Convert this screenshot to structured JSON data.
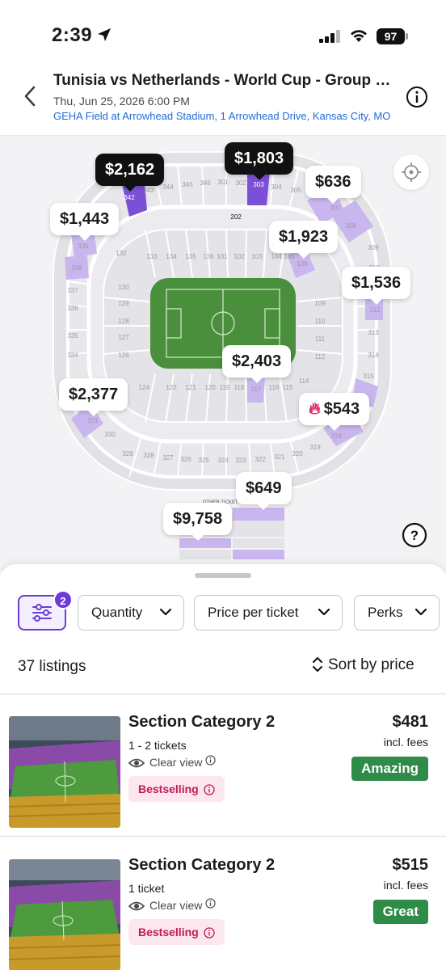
{
  "status_bar": {
    "time": "2:39",
    "battery": "97"
  },
  "event": {
    "title": "Tunisia vs Netherlands - World Cup - Group Stage",
    "datetime": "Thu, Jun 25, 2026 6:00 PM",
    "venue": "GEHA Field at Arrowhead Stadium, 1 Arrowhead Drive, Kansas City, MO"
  },
  "map": {
    "price_pins": [
      {
        "label": "$2,162",
        "style": "dark",
        "section": "342"
      },
      {
        "label": "$1,803",
        "style": "dark",
        "section": "303"
      },
      {
        "label": "$636",
        "style": "light",
        "section": "307"
      },
      {
        "label": "$1,443",
        "style": "light",
        "section": "339"
      },
      {
        "label": "$1,923",
        "style": "light",
        "section": "106"
      },
      {
        "label": "$1,536",
        "style": "light",
        "section": "312"
      },
      {
        "label": "$2,403",
        "style": "light",
        "section": "117"
      },
      {
        "label": "$2,377",
        "style": "light",
        "section": "331"
      },
      {
        "label": "$543",
        "style": "hot",
        "section": "318"
      },
      {
        "label": "$649",
        "style": "light",
        "section": "other"
      },
      {
        "label": "$9,758",
        "style": "light",
        "section": "other"
      }
    ],
    "other_ticket_options_label": "OTHER TICKET OPTIONS",
    "highlight_color": "#c9b6ee",
    "dark_highlight_color": "#7b4fd6"
  },
  "filters": {
    "active_count": "2",
    "chips": [
      "Quantity",
      "Price per ticket",
      "Perks"
    ]
  },
  "results": {
    "count_label": "37 listings",
    "sort_label": "Sort by price"
  },
  "listings": [
    {
      "title": "Section Category 2",
      "quantity": "1 - 2 tickets",
      "view": "Clear view",
      "badge": "Bestselling",
      "price": "$481",
      "fees": "incl. fees",
      "rating": "Amazing"
    },
    {
      "title": "Section Category 2",
      "quantity": "1 ticket",
      "view": "Clear view",
      "badge": "Bestselling",
      "price": "$515",
      "fees": "incl. fees",
      "rating": "Great"
    }
  ]
}
